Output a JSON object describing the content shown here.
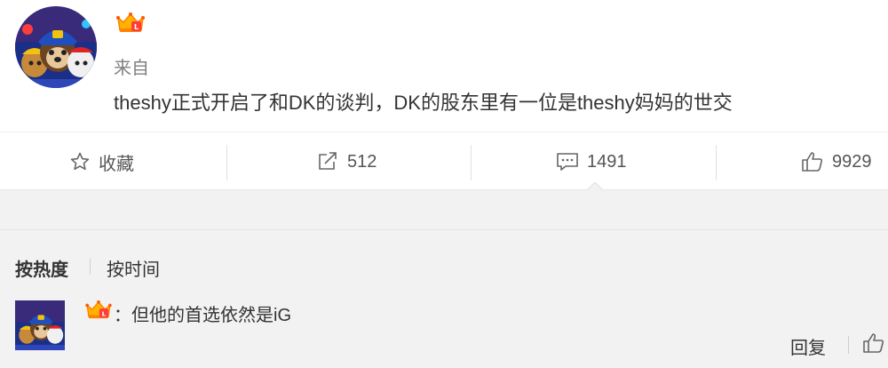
{
  "post": {
    "avatar_icon": "paw-patrol-avatar-icon",
    "badge_icon": "vip-crown-icon",
    "source_label": "来自",
    "text": "theshy正式开启了和DK的谈判，DK的股东里有一位是theshy妈妈的世交"
  },
  "actions": {
    "favorite_label": "收藏",
    "repost_count": "512",
    "comment_count": "1491",
    "like_count": "9929"
  },
  "comments": {
    "sort_hot": "按热度",
    "sort_time": "按时间",
    "items": [
      {
        "avatar_icon": "paw-patrol-avatar-icon",
        "badge_icon": "vip-crown-icon",
        "text": "：但他的首选依然是iG",
        "reply_label": "回复"
      }
    ]
  },
  "colors": {
    "accent_orange": "#ff8200",
    "muted_text": "#808080",
    "comment_bg": "#f2f2f2"
  }
}
